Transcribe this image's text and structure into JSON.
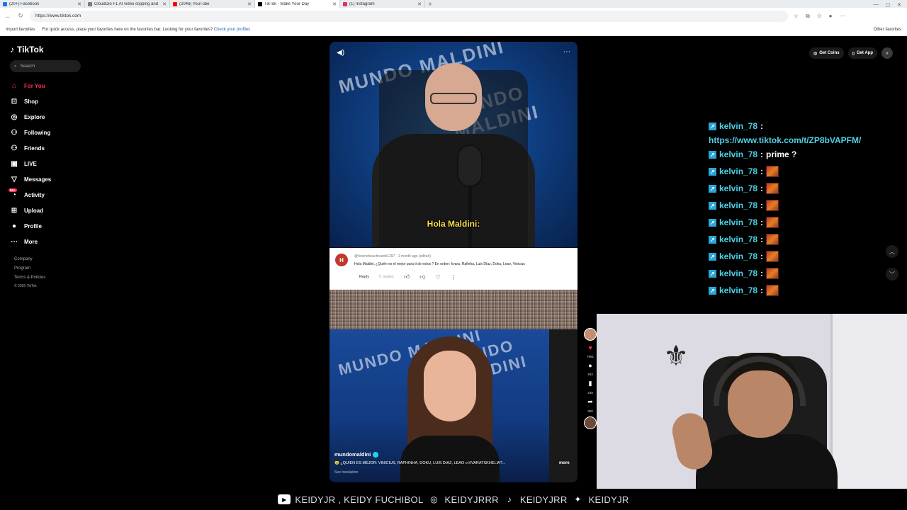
{
  "browser": {
    "tabs": [
      {
        "title": "(20+) Facebook",
        "color": "#1877f2"
      },
      {
        "title": "CloudDio F1 AI video clipping and",
        "color": "#7d7d7d"
      },
      {
        "title": "(2046) YouTube",
        "color": "#ff0000"
      },
      {
        "title": "TikTok - Make Your Day",
        "color": "#000000"
      },
      {
        "title": "(1) Instagram",
        "color": "#e1306c"
      }
    ],
    "url": "https://www.tiktok.com",
    "favbar": {
      "import": "Import favorites",
      "hint": "For quick access, place your favorites here on the favorites bar. Looking for your favorites?",
      "link": "Check your profiles",
      "other": "Other favorites"
    }
  },
  "tiktok": {
    "logo": "TikTok",
    "search_placeholder": "Search",
    "nav": [
      {
        "label": "For You",
        "icon": "home-icon",
        "glyph": "⌂"
      },
      {
        "label": "Shop",
        "icon": "bag-icon",
        "glyph": "⊡"
      },
      {
        "label": "Explore",
        "icon": "compass-icon",
        "glyph": "◎"
      },
      {
        "label": "Following",
        "icon": "user-follow-icon",
        "glyph": "⚇"
      },
      {
        "label": "Friends",
        "icon": "friends-icon",
        "glyph": "⚇"
      },
      {
        "label": "LIVE",
        "icon": "live-icon",
        "glyph": "▣"
      },
      {
        "label": "Messages",
        "icon": "message-icon",
        "glyph": "▽"
      },
      {
        "label": "Activity",
        "icon": "bell-icon",
        "glyph": "◔",
        "badge": "99+"
      },
      {
        "label": "Upload",
        "icon": "upload-icon",
        "glyph": "⊞"
      },
      {
        "label": "Profile",
        "icon": "profile-icon",
        "glyph": "●"
      },
      {
        "label": "More",
        "icon": "more-icon",
        "glyph": "⋯"
      }
    ],
    "footer": {
      "company": "Company",
      "program": "Program",
      "terms": "Terms & Policies",
      "copyright": "© 2026 TikTok"
    },
    "top_actions": {
      "coins": "Get Coins",
      "app": "Get App"
    },
    "video": {
      "caption": "Hola Maldini:",
      "bg_text": "MUNDO MALDINI",
      "comment": {
        "avatar": "H",
        "user": "@hocinebouchoureb1297 · 1 month ago (edited)",
        "text": "Hola Maldini, ¿Quién es el mejor para ti de estos ? En orden: kvara, Rafinha, Luis Díaz, Doku, Leao, Vinicius",
        "reply": "Reply",
        "replies": "0 replies"
      },
      "author": "mundomaldini",
      "description": "😊 ¿QUIÉN ES MEJOR: VINICIUS, RAPHINHA, DOKU, LUIS DÍAZ, LEAO o KVARATSKHELIA?...",
      "more": "more",
      "translation": "See translation"
    },
    "rail": {
      "likes": "7991",
      "comments": "463",
      "saves": "249",
      "shares": "350"
    }
  },
  "chat": {
    "messages": [
      {
        "user": "kelvin_78",
        "text": "",
        "link": "https://www.tiktok.com/t/ZP8bVAPFM/"
      },
      {
        "user": "kelvin_78",
        "text": "prime ?"
      },
      {
        "user": "kelvin_78",
        "emote": true
      },
      {
        "user": "kelvin_78",
        "emote": true
      },
      {
        "user": "kelvin_78",
        "emote": true
      },
      {
        "user": "kelvin_78",
        "emote": true
      },
      {
        "user": "kelvin_78",
        "emote": true
      },
      {
        "user": "kelvin_78",
        "emote": true
      },
      {
        "user": "kelvin_78",
        "emote": true
      },
      {
        "user": "kelvin_78",
        "emote": true
      }
    ],
    "separator": ":"
  },
  "social_bar": {
    "youtube": "KEIDYJR , KEIDY FUCHIBOL",
    "instagram": "KEIDYJRRR",
    "tiktok": "KEIDYJRR",
    "twitter": "KEIDYJR"
  }
}
